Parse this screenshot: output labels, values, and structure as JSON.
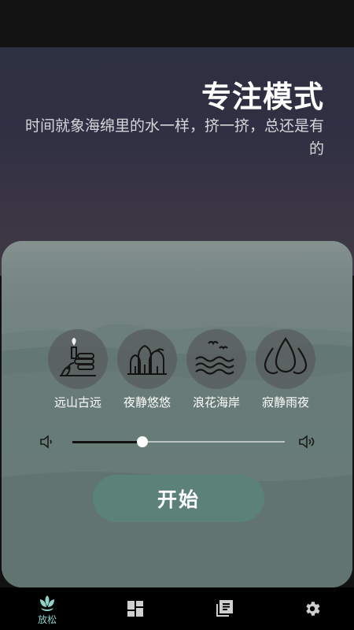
{
  "header": {
    "title": "专注模式",
    "subtitle": "时间就象海绵里的水一样，挤一挤，总还是有的"
  },
  "sounds": [
    {
      "label": "远山古远",
      "icon": "mountain-temple-icon"
    },
    {
      "label": "夜静悠悠",
      "icon": "forest-trees-icon"
    },
    {
      "label": "浪花海岸",
      "icon": "sea-waves-birds-icon"
    },
    {
      "label": "寂静雨夜",
      "icon": "raindrops-icon"
    }
  ],
  "volume": {
    "level": 0.33,
    "low_icon": "volume-low-icon",
    "high_icon": "volume-high-icon"
  },
  "start_button": {
    "label": "开始"
  },
  "bottom_nav": [
    {
      "label": "放松",
      "icon": "lotus-icon",
      "active": true
    },
    {
      "label": "",
      "icon": "dashboard-icon",
      "active": false
    },
    {
      "label": "",
      "icon": "library-icon",
      "active": false
    },
    {
      "label": "",
      "icon": "gear-icon",
      "active": false
    }
  ],
  "colors": {
    "accent": "#8fd1c7",
    "start_button": "#5c847a",
    "nav_background": "#000000"
  }
}
